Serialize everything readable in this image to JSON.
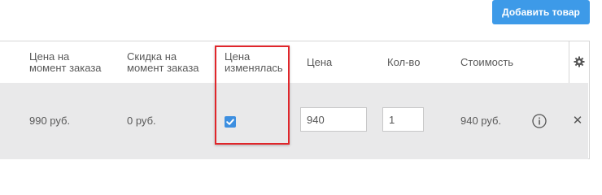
{
  "toolbar": {
    "add_product_label": "Добавить товар"
  },
  "table": {
    "headers": {
      "price_at_order_line1": "Цена на",
      "price_at_order_line2": "момент заказа",
      "discount_at_order_line1": "Скидка на",
      "discount_at_order_line2": "момент заказа",
      "price_changed_line1": "Цена",
      "price_changed_line2": "изменялась",
      "price": "Цена",
      "quantity": "Кол-во",
      "cost": "Стоимость"
    },
    "row": {
      "price_at_order": "990 руб.",
      "discount_at_order": "0 руб.",
      "price_changed_checked": true,
      "price_value": "940",
      "quantity_value": "1",
      "cost": "940 руб."
    }
  },
  "icons": {
    "settings": "gear-icon",
    "info": "info-icon",
    "remove": "close-icon",
    "check": "checkmark-icon"
  },
  "colors": {
    "accent": "#3d9ae8",
    "highlight": "#e0262b",
    "row_background": "#e9e9ea"
  }
}
